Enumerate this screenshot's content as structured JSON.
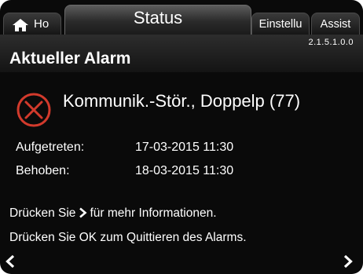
{
  "tabs": {
    "home": "Ho",
    "status": "Status",
    "settings": "Einstellu",
    "assist": "Assist"
  },
  "menu_number": "2.1.5.1.0.0",
  "page_title": "Aktueller Alarm",
  "alarm": {
    "icon": "alarm-x-icon",
    "text": "Kommunik.-Stör., Doppelp (77)"
  },
  "details": {
    "occurred_label": "Aufgetreten:",
    "occurred_value": "17-03-2015 11:30",
    "cleared_label": "Behoben:",
    "cleared_value": "18-03-2015 11:30"
  },
  "hints": {
    "line1_before": "Drücken Sie",
    "line1_after": "für mehr Informationen.",
    "line2": "Drücken Sie OK zum Quittieren des Alarms."
  },
  "colors": {
    "background": "#0a0a0a",
    "alarm_red": "#d23a2c",
    "text": "#ffffff"
  }
}
